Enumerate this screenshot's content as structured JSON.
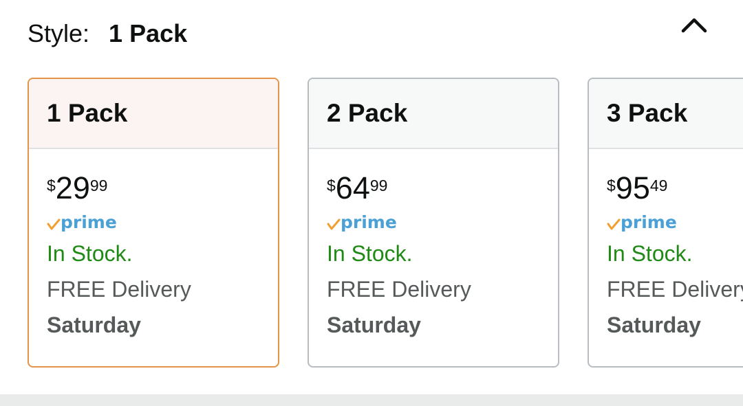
{
  "style": {
    "label": "Style:",
    "value": "1 Pack",
    "collapse_icon": "chevron-up-icon"
  },
  "cards": [
    {
      "title": "1 Pack",
      "selected": true,
      "price": {
        "symbol": "$",
        "whole": "29",
        "fraction": "99"
      },
      "prime": "prime",
      "stock": "In Stock.",
      "delivery": "FREE Delivery",
      "delivery_day": "Saturday"
    },
    {
      "title": "2 Pack",
      "selected": false,
      "price": {
        "symbol": "$",
        "whole": "64",
        "fraction": "99"
      },
      "prime": "prime",
      "stock": "In Stock.",
      "delivery": "FREE Delivery",
      "delivery_day": "Saturday"
    },
    {
      "title": "3 Pack",
      "selected": false,
      "price": {
        "symbol": "$",
        "whole": "95",
        "fraction": "49"
      },
      "prime": "prime",
      "stock": "In Stock.",
      "delivery": "FREE Delivery",
      "delivery_day": "Saturday"
    }
  ],
  "colors": {
    "selected_border": "#e49444",
    "unselected_border": "#b7bcc2",
    "stock_green": "#1f8a15",
    "prime_blue": "#4ba1d6",
    "prime_check_orange": "#f0a030"
  }
}
